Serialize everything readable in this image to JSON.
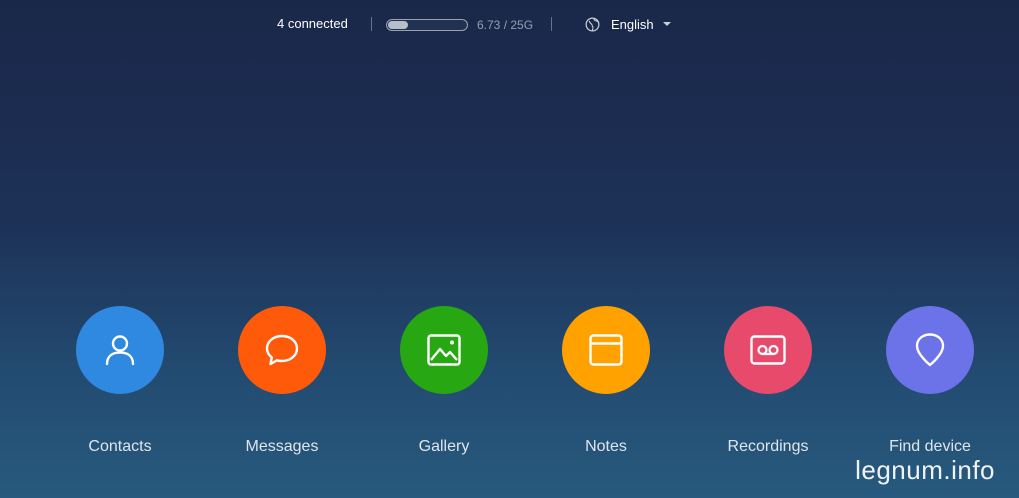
{
  "topbar": {
    "connected_text": "4 connected",
    "storage": {
      "used_fraction": 0.27,
      "text": "6.73 / 25G"
    },
    "language": {
      "icon": "globe-icon",
      "selected": "English"
    }
  },
  "apps": [
    {
      "label": "Contacts",
      "icon": "person-icon",
      "color": "#3089e0"
    },
    {
      "label": "Messages",
      "icon": "chat-bubble-icon",
      "color": "#ff5a0a"
    },
    {
      "label": "Gallery",
      "icon": "image-icon",
      "color": "#27a712"
    },
    {
      "label": "Notes",
      "icon": "note-icon",
      "color": "#ffa200"
    },
    {
      "label": "Recordings",
      "icon": "tape-icon",
      "color": "#e84a6b"
    },
    {
      "label": "Find device",
      "icon": "location-pin-icon",
      "color": "#6c72e8"
    }
  ],
  "watermark": "legnum.info"
}
